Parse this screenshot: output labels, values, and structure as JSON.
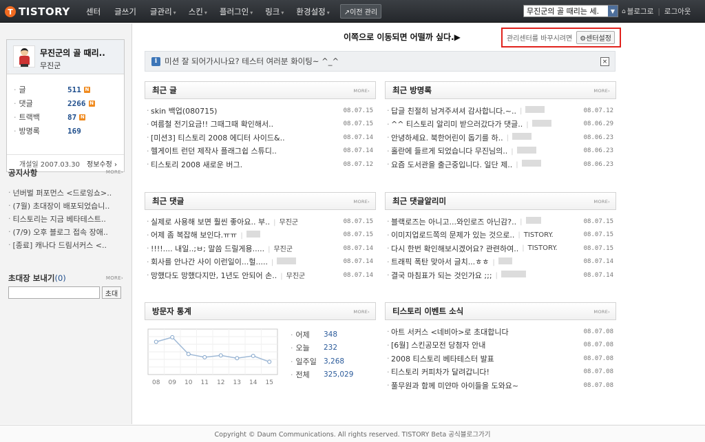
{
  "topbar": {
    "logo_mark": "T",
    "logo_text": "TISTORY",
    "nav": [
      {
        "label": "센터",
        "caret": ""
      },
      {
        "label": "글쓰기",
        "caret": ""
      },
      {
        "label": "글관리",
        "caret": "▾"
      },
      {
        "label": "스킨",
        "caret": "▾"
      },
      {
        "label": "플러그인",
        "caret": "▾"
      },
      {
        "label": "링크",
        "caret": "▾"
      },
      {
        "label": "환경설정",
        "caret": "▾"
      }
    ],
    "prev_manage": "↗이전 관리",
    "blog_select": "무진군의 골 때리는 세.",
    "home_icon": "⌂",
    "blog_link": "블로그로",
    "logout": "로그아웃"
  },
  "profile": {
    "name": "무진군의 골 때리..",
    "sub": "무진군",
    "stats": [
      {
        "label": "글",
        "value": "511",
        "new": "N"
      },
      {
        "label": "댓글",
        "value": "2266",
        "new": "N"
      },
      {
        "label": "트랙백",
        "value": "87",
        "new": "N"
      },
      {
        "label": "방명록",
        "value": "169",
        "new": ""
      }
    ],
    "opened": "개설일 2007.03.30",
    "edit": "정보수정 ›"
  },
  "notice": {
    "title": "공지사항",
    "more": "MORE›",
    "items": [
      "넌버벌 퍼포먼스 <드로잉쇼>..",
      "(7월) 초대장이 배포되었습니..",
      "티스토리는 지금 베타테스트..",
      "(7/9) 오후 블로그 접속 장애..",
      "[종료] 캐나다 드림서커스 <.."
    ]
  },
  "invite": {
    "title": "초대장 보내기",
    "count": "(0)",
    "more": "MORE›",
    "button": "초대",
    "input_value": ""
  },
  "annotation": "이쪽으로 이동되면 어떨까 싶다.▶",
  "center_box": {
    "hint": "관리센터를 바꾸시려면",
    "button": "⚙센터설정"
  },
  "mission": {
    "icon": "i",
    "text": "미션 잘 되어가시나요? 테스터 여러분 화이팅~ ^_^",
    "close": "×"
  },
  "panels": {
    "recent_posts": {
      "title": "최근 글",
      "more": "MORE›",
      "rows": [
        {
          "text": "skin 백업(080715)",
          "author": "",
          "date": "08.07.15"
        },
        {
          "text": "여름철 전기요금!! 그때그때 확인해서..",
          "author": "",
          "date": "08.07.15"
        },
        {
          "text": "[미션3] 티스토리 2008 에디터 사이드&..",
          "author": "",
          "date": "08.07.14"
        },
        {
          "text": "헬게이트 런던 제작사 플래그쉽 스튜디..",
          "author": "",
          "date": "08.07.14"
        },
        {
          "text": "티스토리 2008 새로운 버그.",
          "author": "",
          "date": "08.07.12"
        }
      ]
    },
    "guestbook": {
      "title": "최근 방명록",
      "more": "MORE›",
      "rows": [
        {
          "text": "답글 친절히 남겨주셔셔 감사합니다.~..",
          "author": "",
          "date": "08.07.12"
        },
        {
          "text": "^^ 티스토리 알리미 받으러갔다가 댓글..",
          "author": "",
          "date": "08.06.29"
        },
        {
          "text": "안녕하세요. 북한어린이 돕기를 하..",
          "author": "",
          "date": "08.06.23"
        },
        {
          "text": "홀란에 들르게 되었습니다 무진님의..",
          "author": "",
          "date": "08.06.23"
        },
        {
          "text": "요즘 도서관을 출근중입니다. 일단 제..",
          "author": "",
          "date": "08.06.23"
        }
      ]
    },
    "recent_comments": {
      "title": "최근 댓글",
      "more": "MORE›",
      "rows": [
        {
          "text": "실제로 사용해 보면 훨씬 좋아요.. 부..",
          "author": "무진군",
          "date": "08.07.15"
        },
        {
          "text": "어제 좀 복잡해 보인다.ㅠㅠ",
          "author": "",
          "date": "08.07.15"
        },
        {
          "text": "!!!!.... 내일..;ㅂ; 말씀 드릴게용.....",
          "author": "무진군",
          "date": "08.07.14"
        },
        {
          "text": "회사를 안나간 사이 이런일이...헐.....",
          "author": "",
          "date": "08.07.14"
        },
        {
          "text": "망했다도 망했다지만, 1년도 안되어 손..",
          "author": "무진군",
          "date": "08.07.14"
        }
      ]
    },
    "comment_alarm": {
      "title": "최근 댓글알리미",
      "more": "MORE›",
      "rows": [
        {
          "text": "블랙로즈는 아니고...와인로즈 아닌감?..",
          "author": "",
          "date": "08.07.15"
        },
        {
          "text": "이미지업로드쪽의 문제가 있는 것으로..",
          "author": "TISTORY.",
          "date": "08.07.15"
        },
        {
          "text": "다시 한번 확인해보시겠어요? 관련하여..",
          "author": "TISTORY.",
          "date": "08.07.15"
        },
        {
          "text": "트래픽 폭탄 맞아서 글치...ㅎㅎ",
          "author": "",
          "date": "08.07.14"
        },
        {
          "text": "결국 마침표가 되는 것인가요 ;;;",
          "author": "",
          "date": "08.07.14"
        }
      ]
    },
    "visitors": {
      "title": "방문자 통계",
      "more": "MORE›",
      "stats": [
        {
          "label": "어제",
          "value": "348"
        },
        {
          "label": "오늘",
          "value": "232"
        },
        {
          "label": "일주일",
          "value": "3,268"
        },
        {
          "label": "전체",
          "value": "325,029"
        }
      ]
    },
    "events": {
      "title": "티스토리 이벤트 소식",
      "more": "MORE›",
      "rows": [
        {
          "text": "아트 서커스 <네비아>로 초대합니다",
          "author": "",
          "date": "08.07.08"
        },
        {
          "text": "[6월] 스킨공모전 당첨자 안내",
          "author": "",
          "date": "08.07.08"
        },
        {
          "text": "2008 티스토리 베타테스터 발표",
          "author": "",
          "date": "08.07.08"
        },
        {
          "text": "티스토리 커피차가 달려갑니다!",
          "author": "",
          "date": "08.07.08"
        },
        {
          "text": "풀무원과 함께 미얀마 아이들을 도와요~",
          "author": "",
          "date": "08.07.08"
        }
      ]
    }
  },
  "chart_data": {
    "type": "line",
    "categories": [
      "08",
      "09",
      "10",
      "11",
      "12",
      "13",
      "14",
      "15"
    ],
    "values": [
      7.2,
      8.2,
      4.5,
      3.8,
      4.2,
      3.6,
      4.1,
      2.8
    ],
    "ylim": [
      0,
      10
    ],
    "grid": true,
    "color": "#9fb9d6"
  },
  "footer": {
    "text": "Copyright © Daum Communications. All rights reserved. TISTORY Beta 공식블로그가기"
  }
}
